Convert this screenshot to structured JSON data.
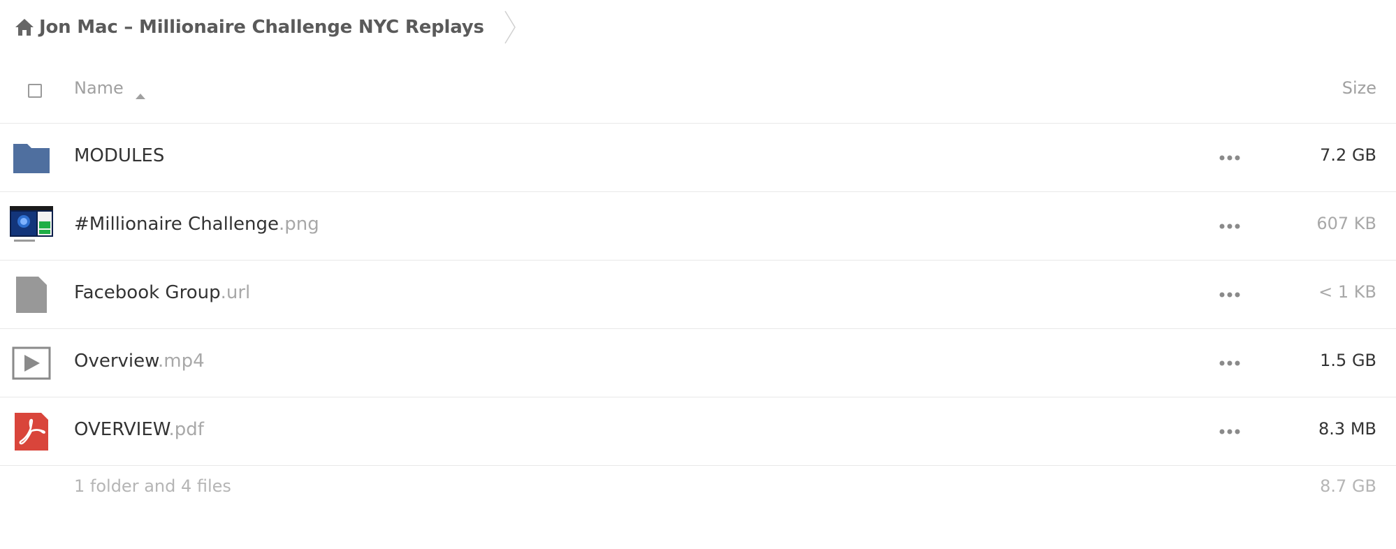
{
  "breadcrumb": {
    "home_icon": "home-icon",
    "title": "Jon Mac – Millionaire Challenge NYC Replays"
  },
  "table": {
    "columns": {
      "name": "Name",
      "size": "Size"
    },
    "sort": "name-ascending",
    "rows": [
      {
        "icon": "folder-icon",
        "base": "MODULES",
        "ext": "",
        "size": "7.2 GB",
        "size_muted": false
      },
      {
        "icon": "image-thumbnail",
        "base": "#Millionaire Challenge",
        "ext": ".png",
        "size": "607 KB",
        "size_muted": true
      },
      {
        "icon": "file-icon",
        "base": "Facebook Group",
        "ext": ".url",
        "size": "< 1 KB",
        "size_muted": true
      },
      {
        "icon": "video-icon",
        "base": "Overview",
        "ext": ".mp4",
        "size": "1.5 GB",
        "size_muted": false
      },
      {
        "icon": "pdf-icon",
        "base": "OVERVIEW",
        "ext": ".pdf",
        "size": "8.3 MB",
        "size_muted": false
      }
    ],
    "more_icon": "more-dots-icon"
  },
  "summary": {
    "text": "1 folder and 4 files",
    "total": "8.7 GB"
  },
  "colors": {
    "folder": "#4f6f9f",
    "pdf": "#d9453b",
    "generic_file": "#989898",
    "muted_text": "#a8a8a8"
  }
}
